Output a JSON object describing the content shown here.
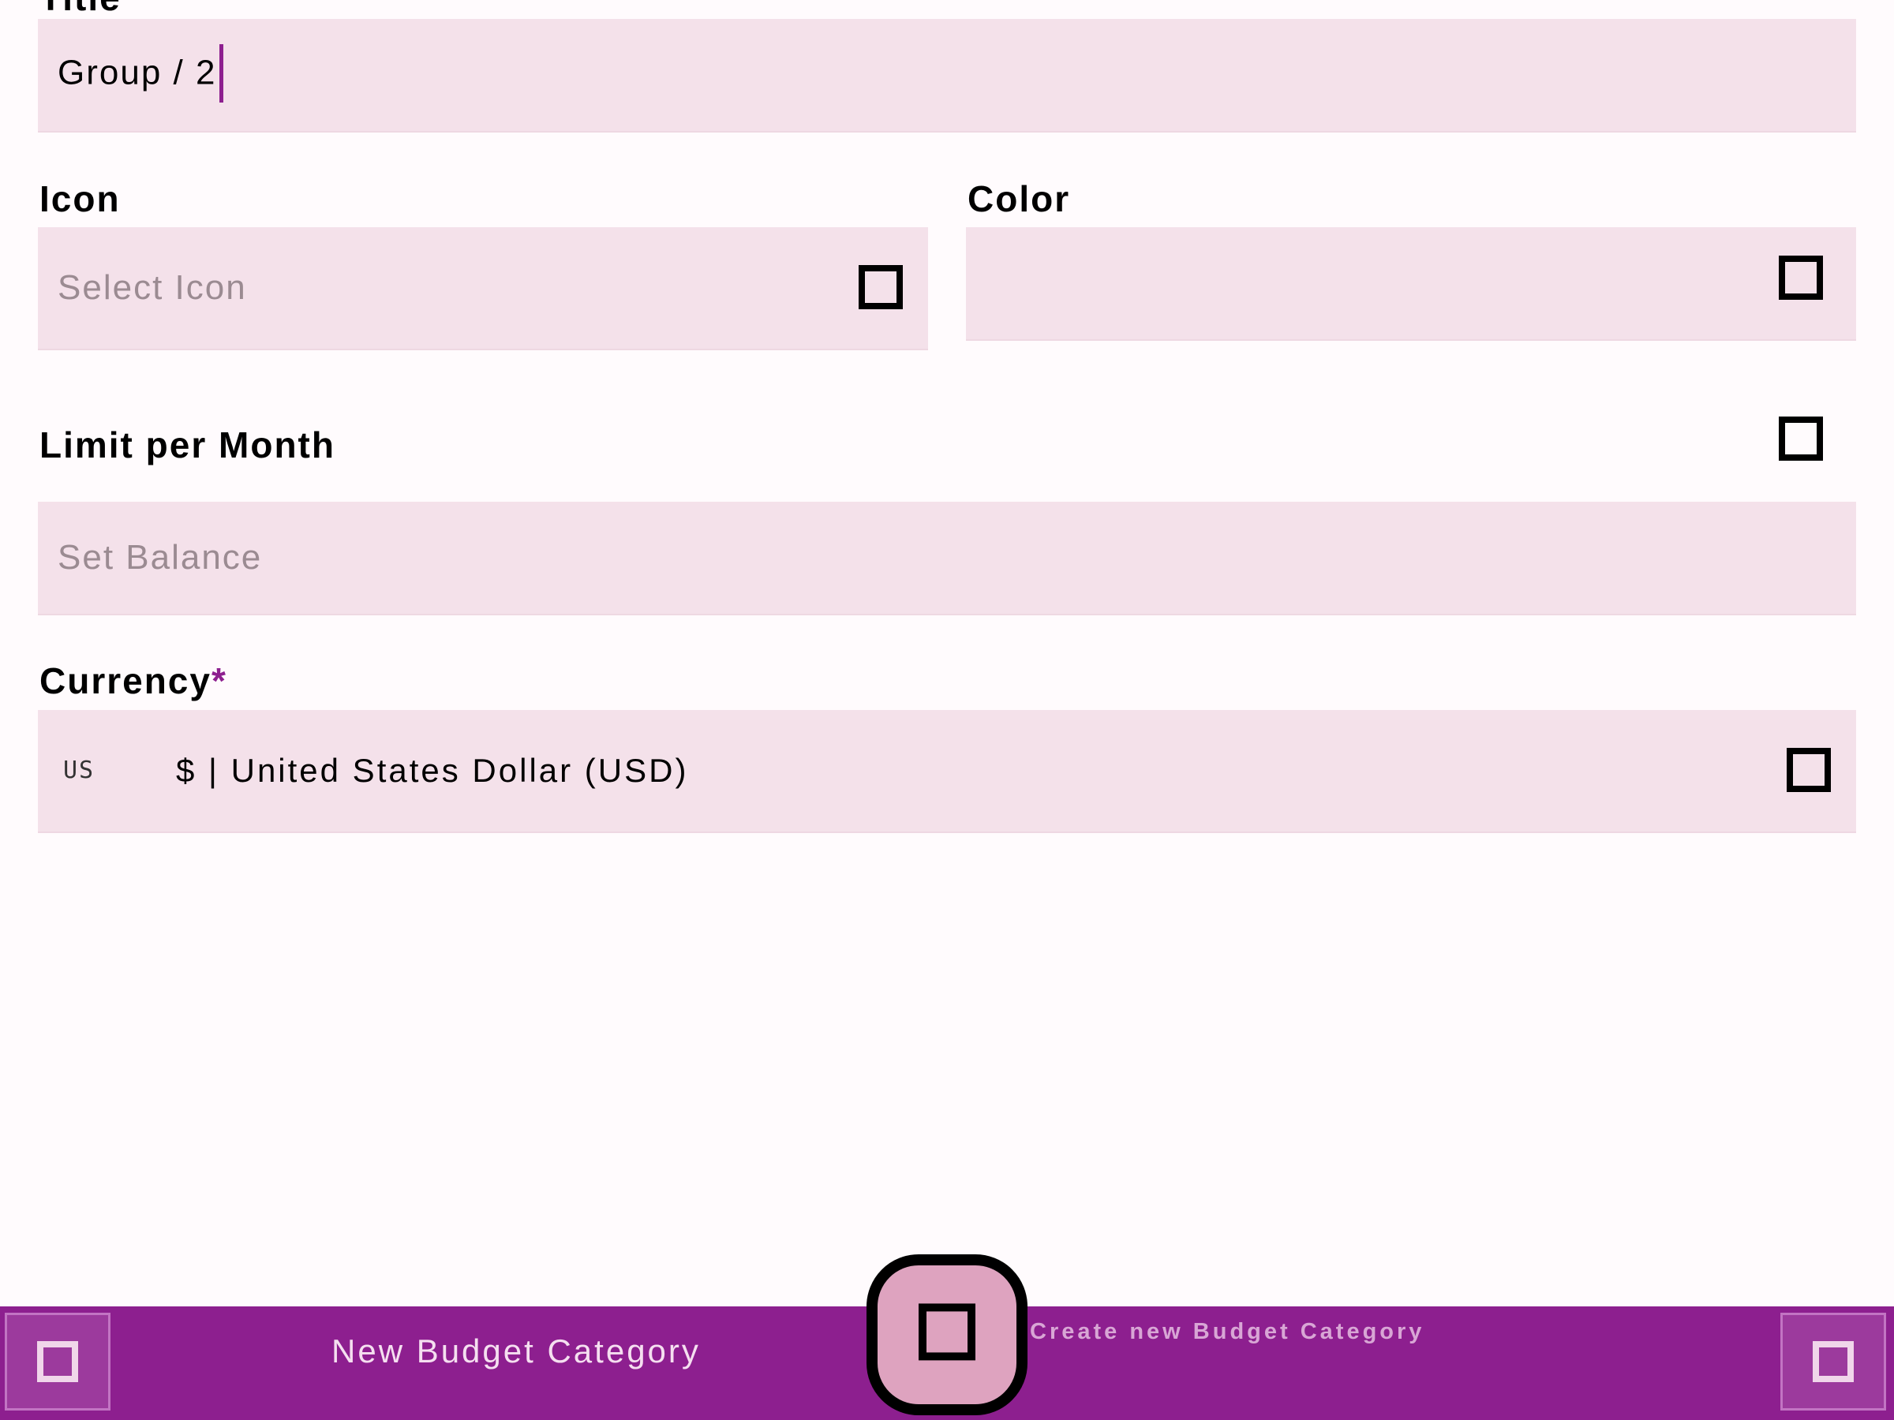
{
  "form": {
    "title": {
      "label": "Title",
      "value": "Group / 2"
    },
    "icon": {
      "label": "Icon",
      "placeholder": "Select Icon",
      "trailing_icon": "dropdown-icon"
    },
    "color": {
      "label": "Color",
      "value": "",
      "trailing_icon": "color-picker-icon"
    },
    "limit": {
      "label": "Limit per Month",
      "toggle_icon": "checkbox-icon",
      "placeholder": "Set Balance"
    },
    "currency": {
      "label": "Currency",
      "required_mark": "*",
      "flag": "US",
      "value": "$ | United States Dollar (USD)",
      "trailing_icon": "dropdown-icon"
    }
  },
  "bottom_bar": {
    "left_icon": "back-icon",
    "title": "New Budget Category",
    "fab_icon": "save-icon",
    "fab_label": "Create new Budget Category",
    "right_icon": "menu-icon"
  },
  "colors": {
    "accent": "#8d1f8f",
    "field_bg": "#f4e1ea",
    "fab_bg": "#dea3bf"
  }
}
